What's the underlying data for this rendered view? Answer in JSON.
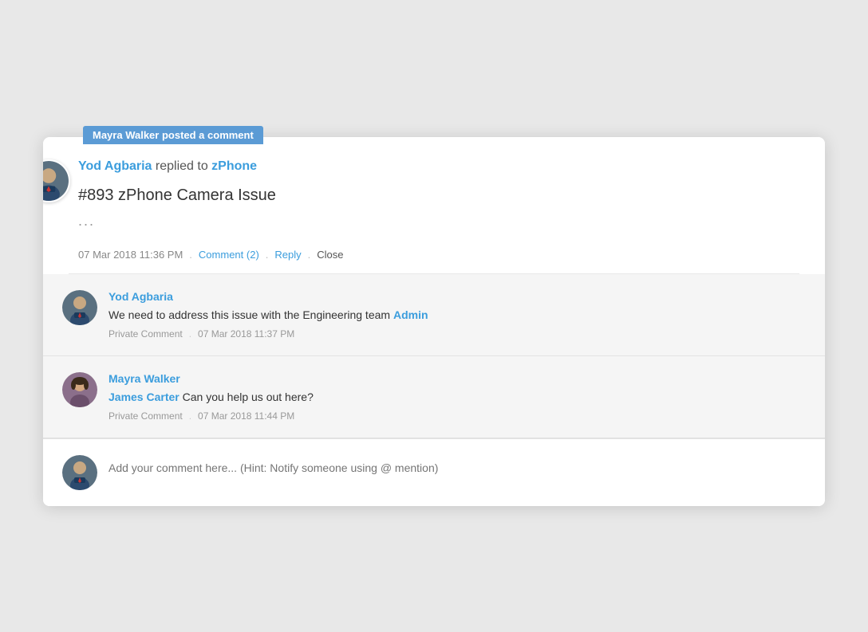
{
  "notification": {
    "poster": "Mayra Walker",
    "action": " posted a comment"
  },
  "post": {
    "author": "Yod Agbaria",
    "verb": " replied to ",
    "target": "zPhone",
    "ticket_title": "#893 zPhone Camera Issue",
    "ellipsis": "...",
    "timestamp": "07 Mar 2018 11:36 PM",
    "comment_label": "Comment (2)",
    "reply_label": "Reply",
    "close_label": "Close"
  },
  "comments": [
    {
      "author": "Yod Agbaria",
      "text_before": "We need to address this issue with the Engineering team ",
      "mention": "Admin",
      "text_after": "",
      "label": "Private Comment",
      "timestamp": "07 Mar 2018 11:37 PM"
    },
    {
      "author": "Mayra Walker",
      "mention": "James Carter",
      "text_body": " Can you help us out here?",
      "label": "Private Comment",
      "timestamp": "07 Mar 2018 11:44 PM"
    }
  ],
  "compose": {
    "placeholder": "Add your comment here... (Hint: Notify someone using @ mention)"
  }
}
